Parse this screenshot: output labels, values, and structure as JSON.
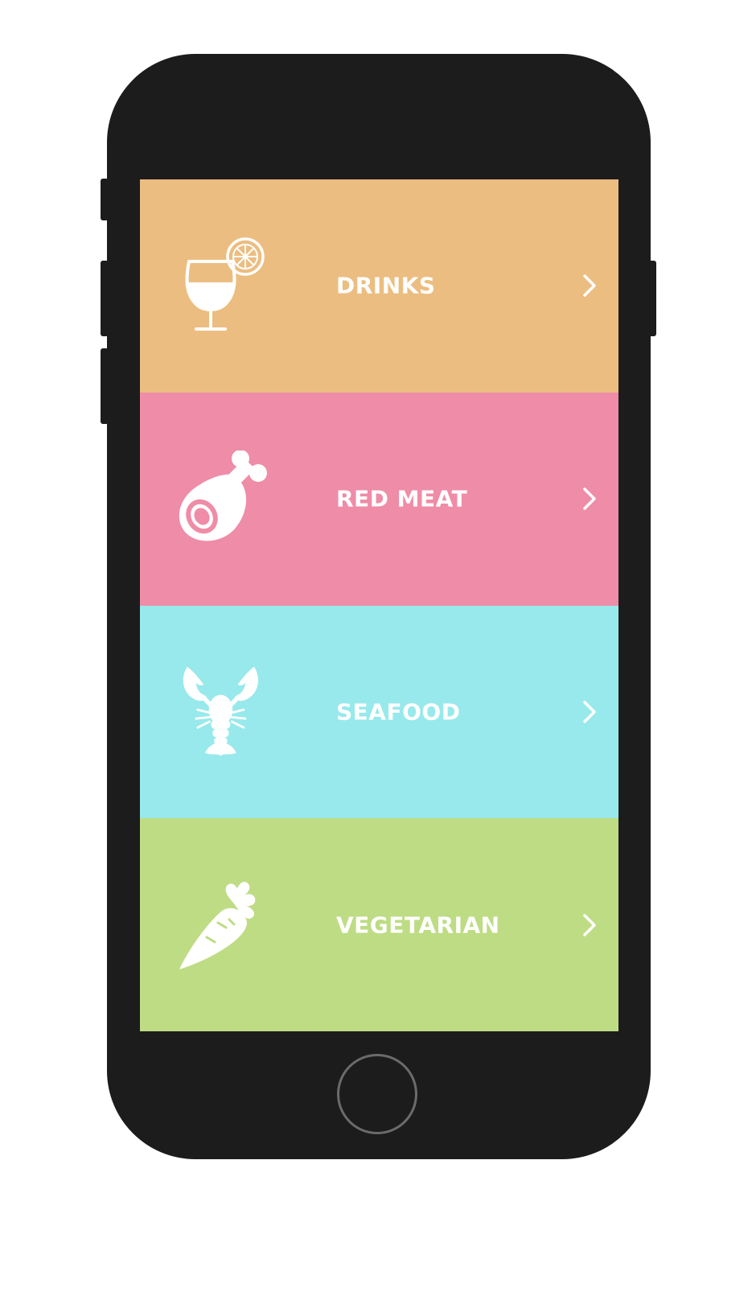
{
  "categories": [
    {
      "id": "drinks",
      "label": "DRINKS",
      "color": "#ECBD80",
      "icon": "wine-glass-icon"
    },
    {
      "id": "red-meat",
      "label": "RED MEAT",
      "color": "#EF8CA7",
      "icon": "ham-leg-icon"
    },
    {
      "id": "seafood",
      "label": "SEAFOOD",
      "color": "#98E9EB",
      "icon": "lobster-icon"
    },
    {
      "id": "vegetarian",
      "label": "VEGETARIAN",
      "color": "#BEDC84",
      "icon": "carrot-icon"
    }
  ],
  "colors": {
    "phone_body": "#1C1C1C",
    "home_ring": "#6B6B6B",
    "text": "#FFFFFF"
  }
}
